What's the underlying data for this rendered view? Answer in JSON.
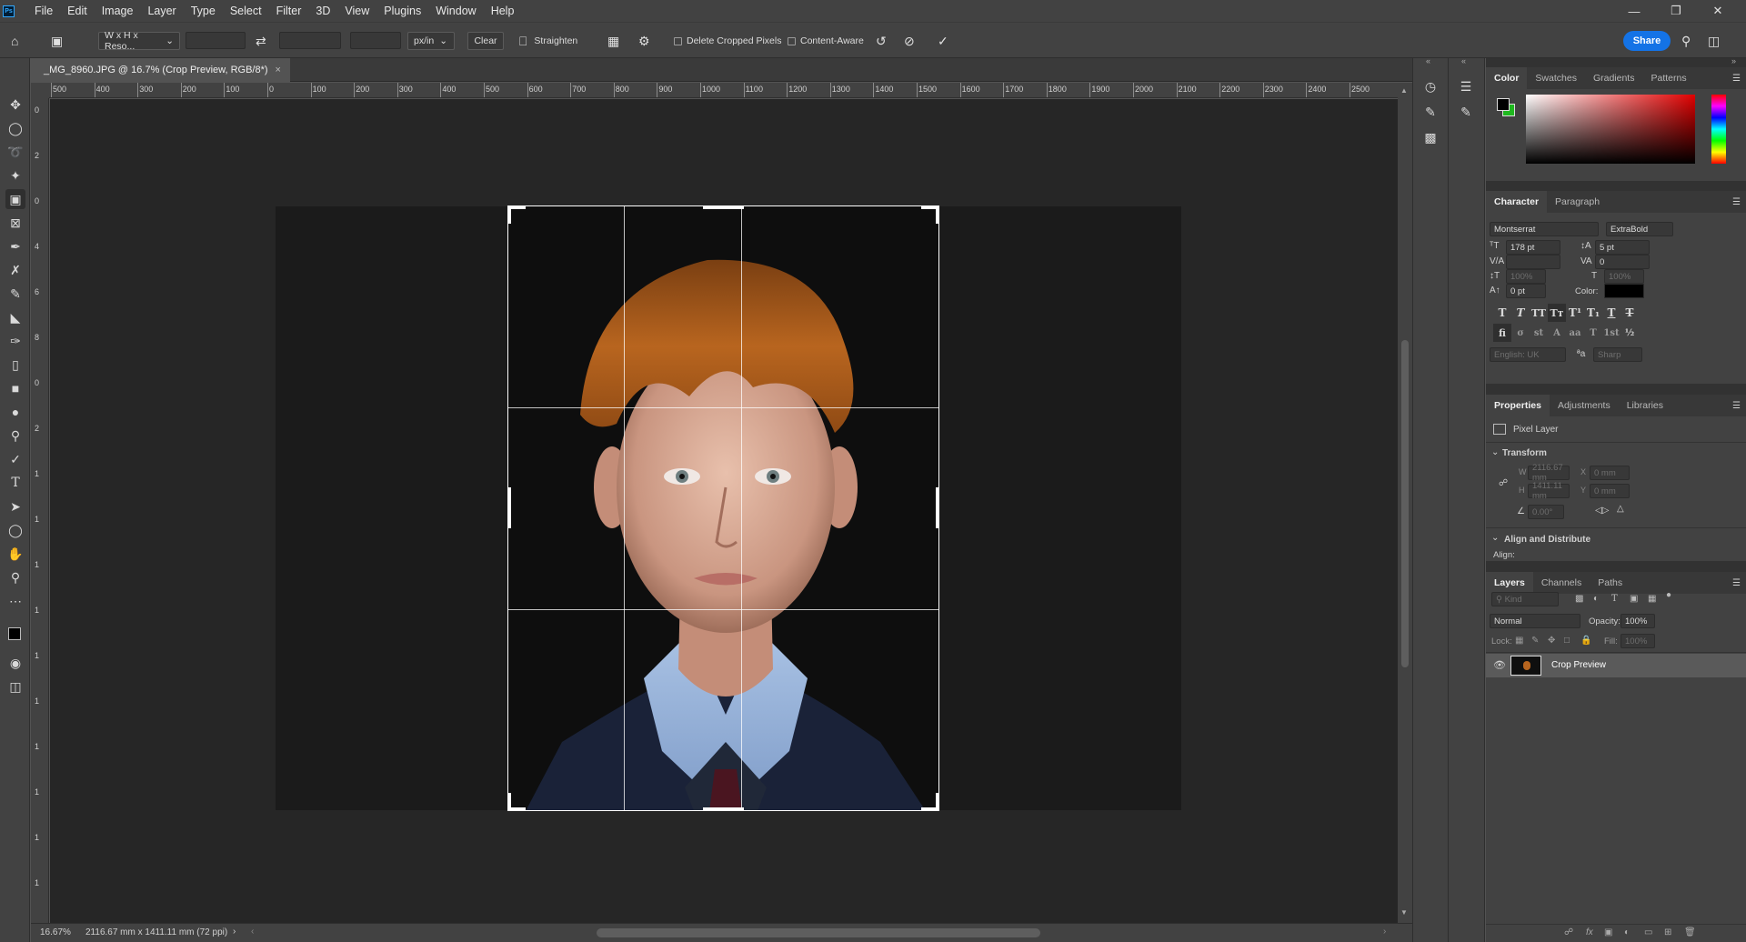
{
  "app": {
    "logo": "Ps"
  },
  "menu": [
    "File",
    "Edit",
    "Image",
    "Layer",
    "Type",
    "Select",
    "Filter",
    "3D",
    "View",
    "Plugins",
    "Window",
    "Help"
  ],
  "options": {
    "ratio_preset": "W x H x Reso...",
    "unit": "px/in",
    "clear": "Clear",
    "straighten": "Straighten",
    "delete_cropped": "Delete Cropped Pixels",
    "content_aware": "Content-Aware",
    "share": "Share"
  },
  "document": {
    "tab_title": "_MG_8960.JPG @ 16.7% (Crop Preview, RGB/8*)",
    "ruler_top": [
      "500",
      "400",
      "300",
      "200",
      "100",
      "0",
      "100",
      "200",
      "300",
      "400",
      "500",
      "600",
      "700",
      "800",
      "900",
      "1000",
      "1100",
      "1200",
      "1300",
      "1400",
      "1500",
      "1600",
      "1700",
      "1800",
      "1900",
      "2000",
      "2100",
      "2200",
      "2300",
      "2400",
      "2500"
    ],
    "ruler_left": [
      "0",
      "2",
      "0",
      "4",
      "6",
      "8",
      "0",
      "2",
      "1",
      "1",
      "1",
      "1",
      "1",
      "1",
      "1",
      "1",
      "1",
      "1"
    ]
  },
  "status": {
    "zoom": "16.67%",
    "dimensions": "2116.67 mm x 1411.11 mm (72 ppi)"
  },
  "color_panel": {
    "tabs": [
      "Color",
      "Swatches",
      "Gradients",
      "Patterns"
    ],
    "fg": "#000000",
    "bg": "#1fb81f"
  },
  "character": {
    "tabs": [
      "Character",
      "Paragraph"
    ],
    "font_family": "Montserrat",
    "font_style": "ExtraBold",
    "size": "178 pt",
    "leading": "5 pt",
    "tracking": "0",
    "vscale": "100%",
    "hscale": "100%",
    "baseline": "0 pt",
    "color_label": "Color:",
    "language": "English: UK",
    "aa_label": "ªa",
    "antialias": "Sharp"
  },
  "properties": {
    "tabs": [
      "Properties",
      "Adjustments",
      "Libraries"
    ],
    "layer_type": "Pixel Layer",
    "transform": "Transform",
    "w_label": "W",
    "w": "2116.67 mm",
    "h_label": "H",
    "h": "1411.11 mm",
    "x_label": "X",
    "x": "0 mm",
    "y_label": "Y",
    "y": "0 mm",
    "angle": "0.00°",
    "align": "Align and Distribute",
    "align_label": "Align:"
  },
  "layers": {
    "tabs": [
      "Layers",
      "Channels",
      "Paths"
    ],
    "kind": "Kind",
    "blend_mode": "Normal",
    "opacity_label": "Opacity:",
    "opacity": "100%",
    "lock_label": "Lock:",
    "fill_label": "Fill:",
    "fill": "100%",
    "items": [
      {
        "name": "Crop Preview"
      }
    ]
  }
}
